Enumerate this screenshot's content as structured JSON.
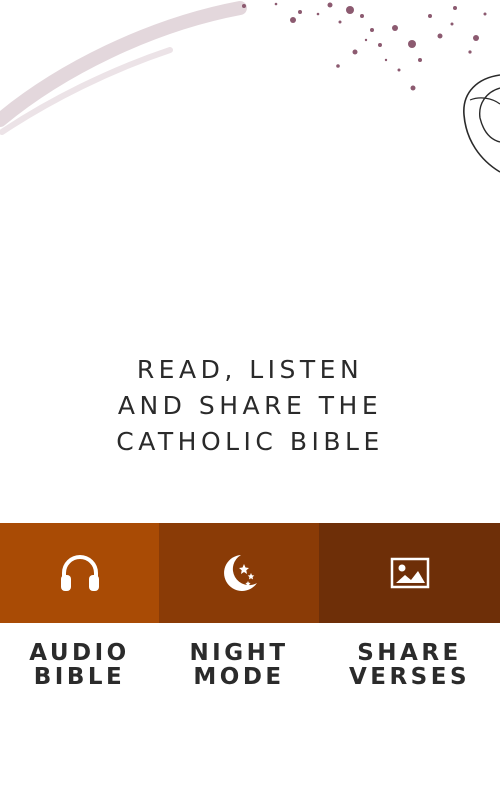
{
  "tagline": {
    "line1": "READ, LISTEN",
    "line2": "AND SHARE THE",
    "line3": "CATHOLIC BIBLE"
  },
  "features": [
    {
      "line1": "AUDIO",
      "line2": "BIBLE",
      "icon": "headphones-icon",
      "color": "#a94b05"
    },
    {
      "line1": "NIGHT",
      "line2": "MODE",
      "icon": "moon-stars-icon",
      "color": "#8a3b06"
    },
    {
      "line1": "SHARE",
      "line2": "VERSES",
      "icon": "image-icon",
      "color": "#6e2f08"
    }
  ],
  "colors": {
    "text": "#2a2a2a",
    "decor": "#7a4a60",
    "brush": "#d9ccd2"
  }
}
